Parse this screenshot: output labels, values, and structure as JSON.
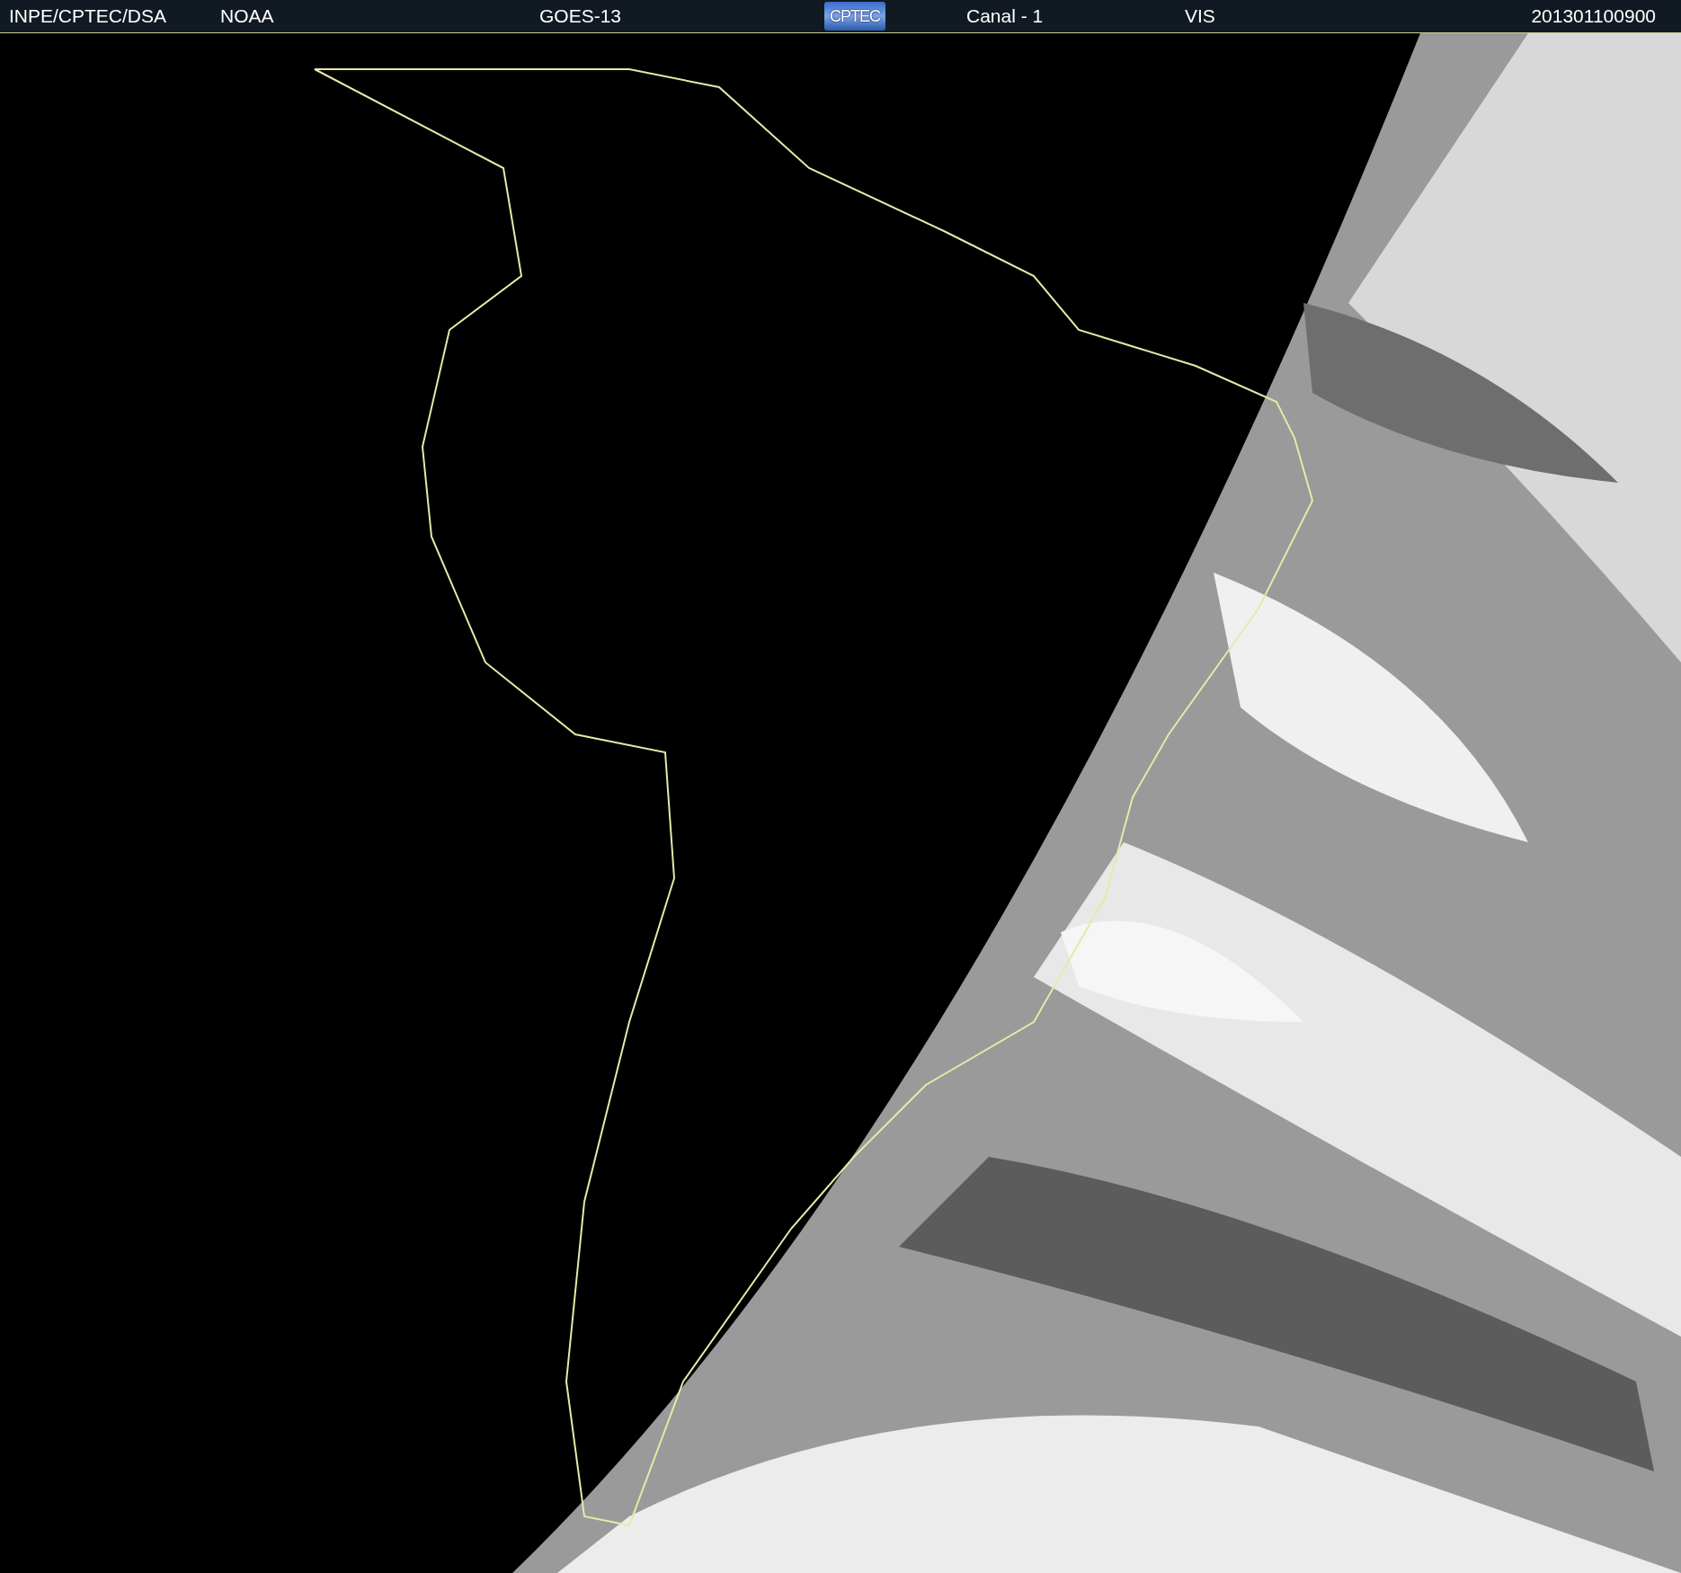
{
  "header": {
    "source": "INPE/CPTEC/DSA",
    "agency": "NOAA",
    "satellite": "GOES-13",
    "logo": "CPTEC",
    "channel": "Canal - 1",
    "band": "VIS",
    "timestamp": "201301100900"
  }
}
